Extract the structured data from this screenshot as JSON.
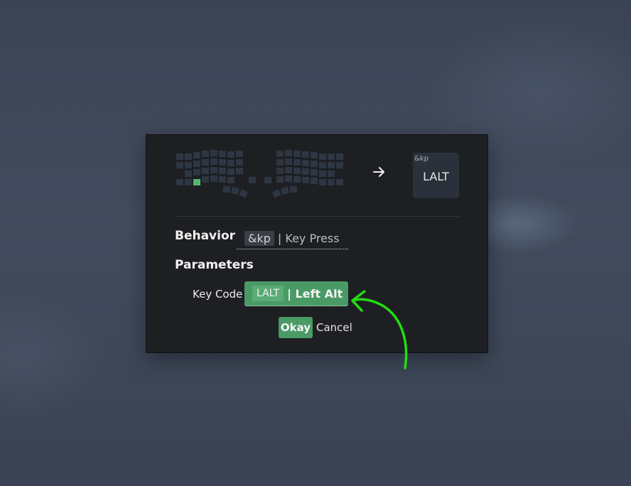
{
  "preview": {
    "arrow_icon": "arrow-right-icon",
    "key_behavior": "&kp",
    "key_param": "LALT"
  },
  "behavior": {
    "label": "Behavior",
    "code": "&kp",
    "name": "| Key Press"
  },
  "parameters": {
    "label": "Parameters",
    "key_code_label": "Key Code",
    "key_code": "LALT",
    "key_name": "| Left Alt"
  },
  "actions": {
    "okay": "Okay",
    "cancel": "Cancel"
  },
  "colors": {
    "accent": "#4a9a66",
    "selected_key": "#56b870",
    "annotation": "#22dd11"
  }
}
